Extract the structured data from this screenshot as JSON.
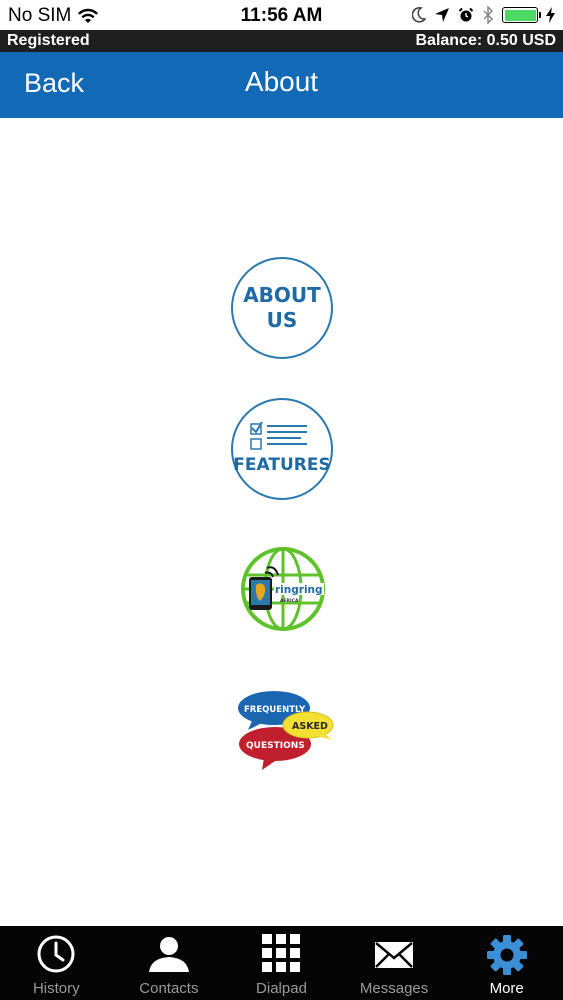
{
  "status_bar": {
    "carrier": "No SIM",
    "time": "11:56 AM",
    "battery_color": "#4cd964"
  },
  "account": {
    "status": "Registered",
    "balance": "Balance: 0.50 USD"
  },
  "nav": {
    "back_label": "Back",
    "title": "About"
  },
  "menu": {
    "about_us": {
      "line1": "ABOUT",
      "line2": "US"
    },
    "features": {
      "label": "FEATURES"
    },
    "ringring": {
      "brand": "ringring",
      "sub": "AFRICA"
    },
    "faq": {
      "word1": "FREQUENTLY",
      "word2": "ASKED",
      "word3": "QUESTIONS"
    }
  },
  "tabs": [
    {
      "label": "History",
      "icon": "clock-icon"
    },
    {
      "label": "Contacts",
      "icon": "person-icon"
    },
    {
      "label": "Dialpad",
      "icon": "dialpad-icon"
    },
    {
      "label": "Messages",
      "icon": "envelope-icon"
    },
    {
      "label": "More",
      "icon": "gear-icon",
      "active": true
    }
  ],
  "colors": {
    "nav_bar": "#1269b6",
    "accent_blue": "#1e6aa5",
    "globe_green": "#5fc22a",
    "faq_blue": "#1a66b0",
    "faq_red": "#c0202e",
    "faq_yellow": "#f2e032",
    "active_tab_icon": "#3b8fd6"
  }
}
